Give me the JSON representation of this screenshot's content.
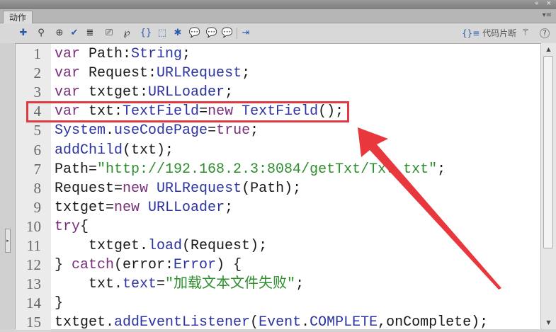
{
  "window": {
    "collapse_icon": "«",
    "close_icon": "×"
  },
  "panel": {
    "tab_label": "动作",
    "menu_icon": "▾≡"
  },
  "toolbar": {
    "snippets_label": "代码片断",
    "help": "?"
  },
  "highlight": {
    "line": 4,
    "color": "#e0393f"
  },
  "code": {
    "lines": [
      {
        "n": "1",
        "t": [
          [
            "var",
            "kw"
          ],
          [
            " Path:",
            ""
          ],
          [
            "String",
            "ty"
          ],
          [
            ";",
            ""
          ]
        ]
      },
      {
        "n": "2",
        "t": [
          [
            "var",
            "kw"
          ],
          [
            " Request:",
            ""
          ],
          [
            "URLRequest",
            "ty"
          ],
          [
            ";",
            ""
          ]
        ]
      },
      {
        "n": "3",
        "t": [
          [
            "var",
            "kw"
          ],
          [
            " txtget:",
            ""
          ],
          [
            "URLLoader",
            "ty"
          ],
          [
            ";",
            ""
          ]
        ]
      },
      {
        "n": "4",
        "t": [
          [
            "var",
            "kw"
          ],
          [
            " txt:",
            ""
          ],
          [
            "TextField",
            "ty"
          ],
          [
            "=",
            ""
          ],
          [
            "new",
            "kw"
          ],
          [
            " ",
            ""
          ],
          [
            "TextField",
            "ty"
          ],
          [
            "();",
            ""
          ]
        ]
      },
      {
        "n": "5",
        "t": [
          [
            "System",
            "ty"
          ],
          [
            ".",
            ""
          ],
          [
            "useCodePage",
            "fn"
          ],
          [
            "=",
            ""
          ],
          [
            "true",
            "kw"
          ],
          [
            ";",
            ""
          ]
        ]
      },
      {
        "n": "6",
        "t": [
          [
            "addChild",
            "fn"
          ],
          [
            "(txt);",
            ""
          ]
        ]
      },
      {
        "n": "7",
        "t": [
          [
            "Path=",
            ""
          ],
          [
            "\"http://192.168.2.3:8084/getTxt/Txt.txt\"",
            "st"
          ],
          [
            ";",
            ""
          ]
        ]
      },
      {
        "n": "8",
        "t": [
          [
            "Request=",
            ""
          ],
          [
            "new",
            "kw"
          ],
          [
            " ",
            ""
          ],
          [
            "URLRequest",
            "ty"
          ],
          [
            "(Path);",
            ""
          ]
        ]
      },
      {
        "n": "9",
        "t": [
          [
            "txtget=",
            ""
          ],
          [
            "new",
            "kw"
          ],
          [
            " ",
            ""
          ],
          [
            "URLLoader",
            "ty"
          ],
          [
            ";",
            ""
          ]
        ]
      },
      {
        "n": "10",
        "t": [
          [
            "try",
            "kw"
          ],
          [
            "{",
            ""
          ]
        ]
      },
      {
        "n": "11",
        "t": [
          [
            "    txtget.",
            ""
          ],
          [
            "load",
            "fn"
          ],
          [
            "(Request);",
            ""
          ]
        ]
      },
      {
        "n": "12",
        "t": [
          [
            "} ",
            ""
          ],
          [
            "catch",
            "kw"
          ],
          [
            "(error:",
            ""
          ],
          [
            "Error",
            "ty"
          ],
          [
            ") {",
            ""
          ]
        ]
      },
      {
        "n": "13",
        "t": [
          [
            "    txt.",
            ""
          ],
          [
            "text",
            "fn"
          ],
          [
            "=",
            ""
          ],
          [
            "\"加载文本文件失败\"",
            "st"
          ],
          [
            ";",
            ""
          ]
        ]
      },
      {
        "n": "14",
        "t": [
          [
            "}",
            ""
          ]
        ]
      },
      {
        "n": "15",
        "t": [
          [
            "txtget.",
            ""
          ],
          [
            "addEventListener",
            "fn"
          ],
          [
            "(",
            ""
          ],
          [
            "Event",
            "ty"
          ],
          [
            ".",
            ""
          ],
          [
            "COMPLETE",
            "ty"
          ],
          [
            ",onComplete);",
            ""
          ]
        ]
      }
    ]
  }
}
